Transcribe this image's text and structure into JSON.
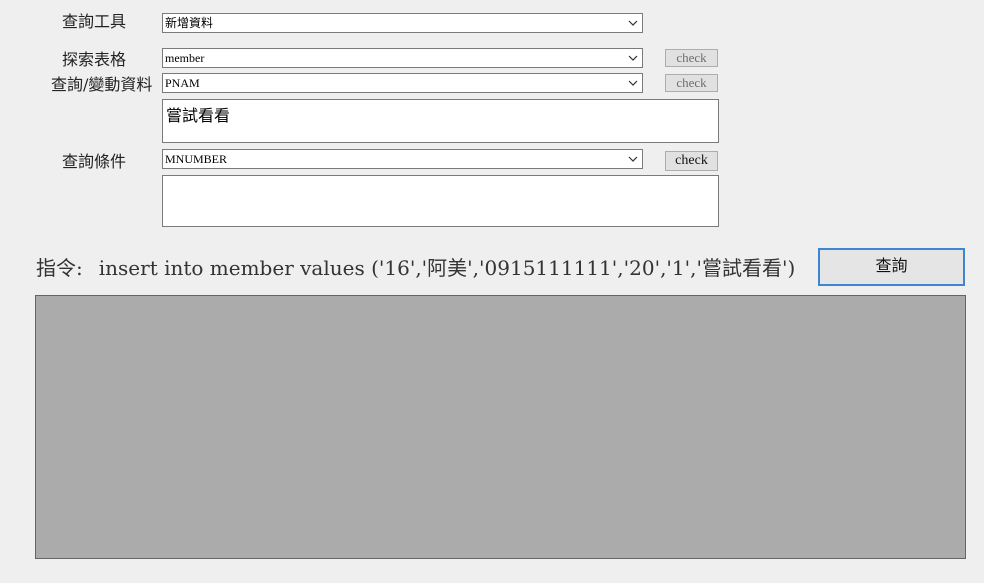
{
  "form": {
    "tool_label": "查詢工具",
    "tool_value": "新增資料",
    "table_label": "探索表格",
    "table_value": "member",
    "table_check": "check",
    "column_label": "查詢/變動資料",
    "column_value": "PNAM",
    "column_check": "check",
    "column_text": "嘗試看看",
    "condition_label": "查詢條件",
    "condition_value": "MNUMBER",
    "condition_check": "check",
    "condition_text": ""
  },
  "command": {
    "label": "指令:",
    "text": "insert into member values ('16','阿美','0915111111','20','1','嘗試看看')"
  },
  "query_button": "查詢",
  "icons": {
    "dropdown": "chevron-down-icon"
  },
  "colors": {
    "background": "#efefef",
    "grid": "#ababab",
    "focus_border": "#3e86d1"
  }
}
